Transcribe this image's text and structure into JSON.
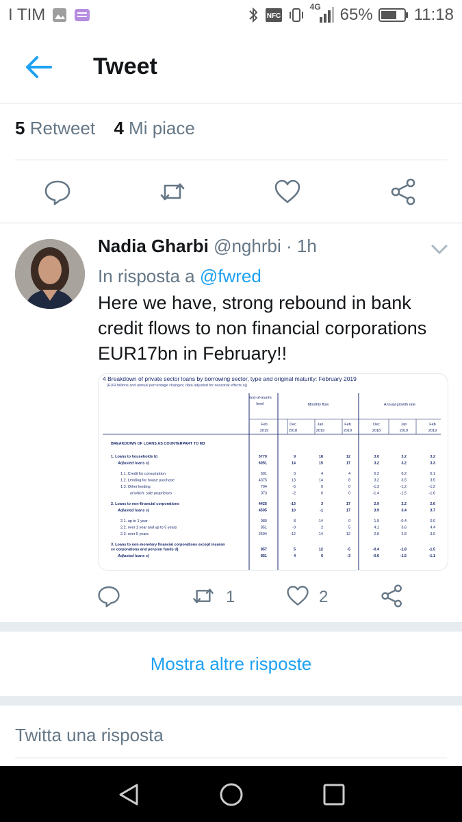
{
  "status_bar": {
    "carrier": "I TIM",
    "network": "4G",
    "battery_percent": "65%",
    "time": "11:18",
    "icons": [
      "gallery-icon",
      "keyboard-icon",
      "bluetooth-icon",
      "nfc-icon",
      "vibrate-icon",
      "signal-icon",
      "battery-icon"
    ]
  },
  "app_bar": {
    "title": "Tweet",
    "back_icon": "arrow-left-icon"
  },
  "stats": {
    "retweets_count": "5",
    "retweets_label": "Retweet",
    "likes_count": "4",
    "likes_label": "Mi piace"
  },
  "main_actions": [
    "reply-icon",
    "retweet-icon",
    "heart-icon",
    "share-icon"
  ],
  "reply_tweet": {
    "name": "Nadia Gharbi",
    "handle": "@nghrbi",
    "separator": "·",
    "time": "1h",
    "in_reply_prefix": "In risposta a",
    "in_reply_handle": "@fwred",
    "text": "Here we have, strong rebound in bank credit flows to non financial corporations EUR17bn in February!!",
    "retweet_count": "1",
    "like_count": "2",
    "media_table": {
      "title": "4 Breakdown of private sector loans by borrowing sector, type and original maturity: February 2019",
      "subtitle": "(EUR billions and annual percentage changes; data adjusted for seasonal effects a))",
      "group_headers": [
        "End-of-month level",
        "Monthly flow",
        "Annual growth rate"
      ],
      "subheaders": [
        "Feb 2019",
        "Dec 2018",
        "Jan 2019",
        "Feb 2019",
        "Dec 2018",
        "Jan 2019",
        "Feb 2019"
      ],
      "section_title": "BREAKDOWN OF LOANS AS COUNTERPART TO M3",
      "rows": [
        {
          "label": "1. Loans to households b)",
          "values": [
            "5770",
            "9",
            "18",
            "12",
            "3.0",
            "3.2",
            "3.2"
          ],
          "bold": true
        },
        {
          "label": "Adjusted loans c)",
          "values": [
            "6051",
            "14",
            "15",
            "17",
            "3.2",
            "3.2",
            "3.3"
          ],
          "bold": true,
          "italic": true
        },
        {
          "label": "",
          "values": [
            "",
            "",
            "",
            "",
            "",
            "",
            ""
          ]
        },
        {
          "label": "1.1. Credit for consumption",
          "values": [
            "691",
            "0",
            "4",
            "4",
            "6.2",
            "6.2",
            "6.1"
          ]
        },
        {
          "label": "1.2. Lending for house purchase",
          "values": [
            "4375",
            "13",
            "14",
            "8",
            "3.2",
            "3.5",
            "3.5"
          ]
        },
        {
          "label": "1.3. Other lending",
          "values": [
            "704",
            "-5",
            "0",
            "0",
            "-1.3",
            "-1.2",
            "-1.2"
          ]
        },
        {
          "label": "of which: sole proprietors",
          "values": [
            "373",
            "-2",
            "0",
            "0",
            "-1.4",
            "-1.5",
            "-1.6"
          ],
          "italic": true
        },
        {
          "label": "",
          "values": [
            "",
            "",
            "",
            "",
            "",
            "",
            ""
          ]
        },
        {
          "label": "2. Loans to non-financial corporations",
          "values": [
            "4425",
            "-13",
            "3",
            "17",
            "2.9",
            "2.2",
            "2.6"
          ],
          "bold": true
        },
        {
          "label": "Adjusted loans c)",
          "values": [
            "4505",
            "10",
            "-1",
            "17",
            "3.9",
            "3.4",
            "3.7"
          ],
          "bold": true,
          "italic": true
        },
        {
          "label": "",
          "values": [
            "",
            "",
            "",
            "",
            "",
            "",
            ""
          ]
        },
        {
          "label": "2.1. up to 1 year",
          "values": [
            "980",
            "8",
            "-14",
            "0",
            "1.9",
            "-0.4",
            "0.0"
          ]
        },
        {
          "label": "2.2. over 1 year and up to 5 years",
          "values": [
            "851",
            "-9",
            "2",
            "5",
            "4.1",
            "3.6",
            "4.4"
          ]
        },
        {
          "label": "2.3. over 5 years",
          "values": [
            "2594",
            "-12",
            "14",
            "12",
            "2.8",
            "2.8",
            "3.0"
          ]
        },
        {
          "label": "",
          "values": [
            "",
            "",
            "",
            "",
            "",
            "",
            ""
          ]
        },
        {
          "label": "3. Loans to non-monetary financial corporations except insurance corporations and pension funds d)",
          "values": [
            "857",
            "5",
            "12",
            "-5",
            "-0.4",
            "-1.8",
            "-1.5"
          ],
          "bold": true
        },
        {
          "label": "Adjusted loans c)",
          "values": [
            "851",
            "4",
            "6",
            "-3",
            "-0.6",
            "-1.5",
            "-1.1"
          ],
          "bold": true,
          "italic": true
        }
      ]
    }
  },
  "more_replies_label": "Mostra altre risposte",
  "reply_placeholder": "Twitta una risposta",
  "nav_bar": [
    "back-triangle-icon",
    "home-circle-icon",
    "recents-square-icon"
  ]
}
